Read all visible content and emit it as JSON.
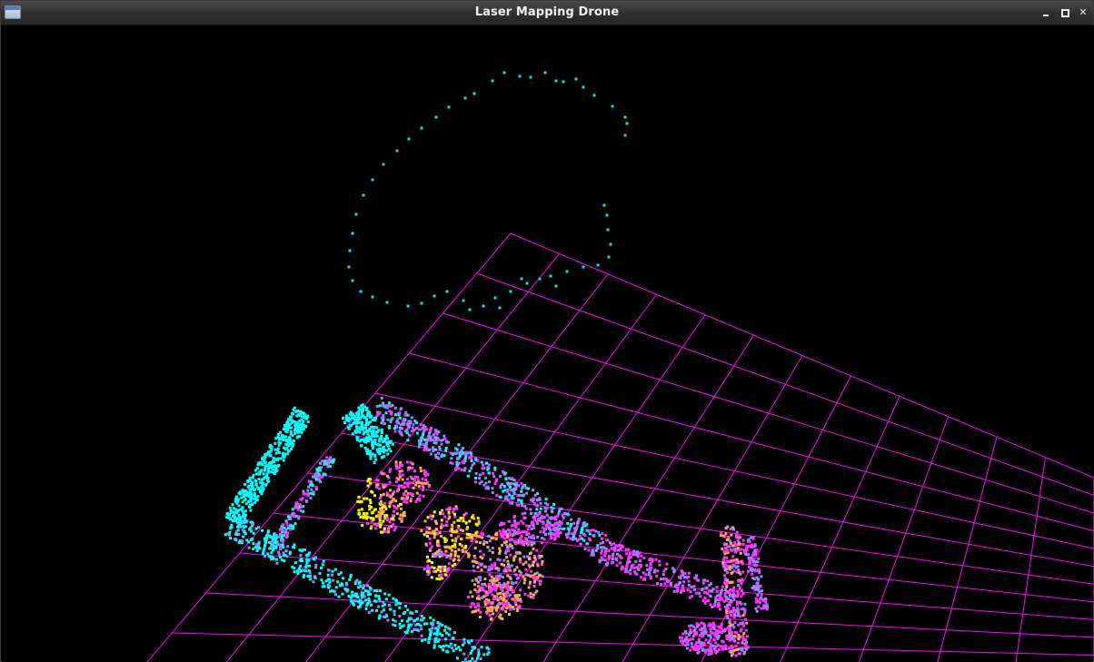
{
  "window": {
    "title": "Laser Mapping Drone",
    "icon": "app-window-icon",
    "controls": [
      {
        "name": "minimize-button",
        "icon": "minimize-icon"
      },
      {
        "name": "maximize-button",
        "icon": "maximize-icon"
      },
      {
        "name": "close-button",
        "icon": "close-icon"
      }
    ]
  },
  "scene": {
    "background_color": "#000000",
    "grid_color": "#ff00ff",
    "trajectory_color": "#00e5e5",
    "point_cloud_colors": [
      "#00ffff",
      "#8c8cff",
      "#ff33ff",
      "#ffaa55",
      "#ffff00"
    ]
  }
}
